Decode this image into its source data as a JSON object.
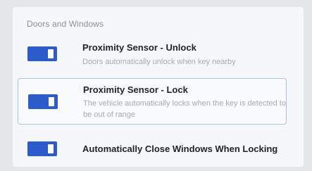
{
  "section": {
    "title": "Doors and Windows"
  },
  "settings": [
    {
      "label": "Proximity Sensor - Unlock",
      "description": "Doors automatically unlock when key nearby",
      "enabled": true
    },
    {
      "label": "Proximity Sensor - Lock",
      "description": "The vehicle automatically locks when the key is detected to be out of range",
      "enabled": true,
      "selected": true
    },
    {
      "label": "Automatically Close Windows When Locking",
      "enabled": true
    }
  ],
  "colors": {
    "toggle_on": "#2b5cc9",
    "selection_border": "#aac4e6"
  }
}
